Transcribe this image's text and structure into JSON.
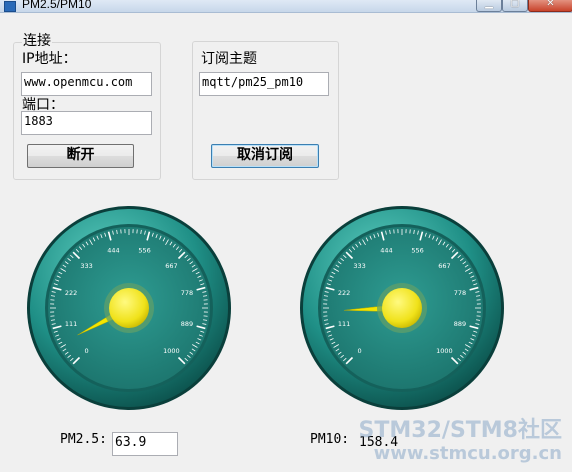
{
  "window": {
    "title": "PM2.5/PM10"
  },
  "connection": {
    "group_title": "连接",
    "ip_label": "IP地址：",
    "ip_value": "www.openmcu.com",
    "port_label": "端口：",
    "port_value": "1883",
    "disconnect_label": "断开"
  },
  "subscription": {
    "group_title": "订阅主题",
    "topic_value": "mqtt/pm25_pm10",
    "unsubscribe_label": "取消订阅"
  },
  "gauges": [
    {
      "name": "pm25",
      "value": 63.9,
      "min": 0,
      "max": 1000
    },
    {
      "name": "pm10",
      "value": 158.4,
      "min": 0,
      "max": 1000
    }
  ],
  "gauge_scale_labels": [
    "0",
    "111",
    "222",
    "333",
    "444",
    "556",
    "667",
    "778",
    "889",
    "1000"
  ],
  "readouts": {
    "pm25_label": "PM2.5:",
    "pm25_value": "63.9",
    "pm10_label": "PM10:",
    "pm10_value": "158.4"
  },
  "watermark": {
    "line1": "STM32/STM8社区",
    "line2": "www.stmcu.org.cn"
  },
  "colors": {
    "dial_teal": "#1f8f86",
    "hub_yellow": "#f0e21a",
    "needle_yellow": "#f3e600"
  }
}
